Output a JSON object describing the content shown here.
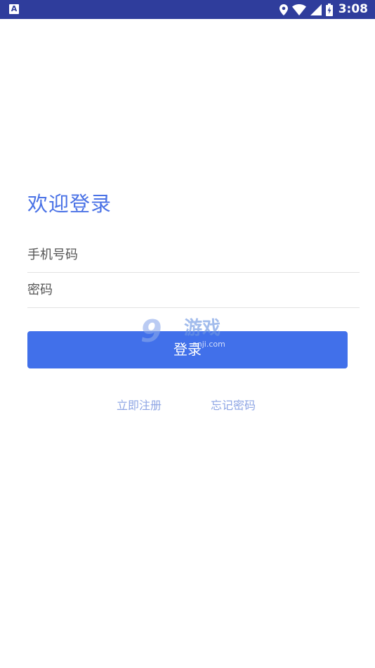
{
  "status_bar": {
    "left_icon": "A",
    "time": "3:08",
    "icons": [
      "location-icon",
      "wifi-icon",
      "signal-icon",
      "battery-icon"
    ],
    "color": "#2f3d9c"
  },
  "login": {
    "title": "欢迎登录",
    "phone_placeholder": "手机号码",
    "password_placeholder": "密码",
    "login_button": "登录",
    "register_link": "立即注册",
    "forgot_link": "忘记密码"
  },
  "watermark": {
    "big": "9",
    "game": "游戏",
    "url": "anji.com"
  },
  "colors": {
    "accent": "#4170ea",
    "title": "#4a72e6",
    "link": "#8ea5e4"
  }
}
